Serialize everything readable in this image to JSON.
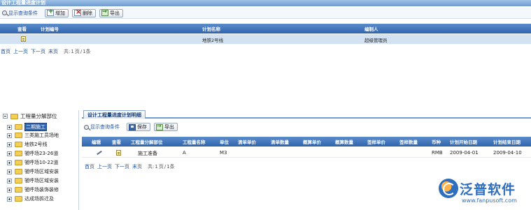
{
  "top_panel": {
    "title": "设计工程量进度计划",
    "toolbar": {
      "show_query": "显示查询条件",
      "add": "增加",
      "delete": "删除",
      "export": "导出"
    },
    "columns": [
      "查看",
      "计划编号",
      "计划名称",
      "编制人"
    ],
    "rows": [
      {
        "plan_no": "",
        "plan_name": "地铁2号线",
        "author": "超级管理员"
      }
    ],
    "pager": {
      "first": "首页",
      "prev": "上一页",
      "next": "下一页",
      "last": "末页",
      "total_label": "共:",
      "current": "1",
      "page_unit": "页",
      "sep": "/",
      "total_count": "1条"
    }
  },
  "tree": {
    "root": "工程量分解部位",
    "items": [
      {
        "label": "二期施工",
        "selected": true
      },
      {
        "label": "三类施工员场地"
      },
      {
        "label": "地铁2号线"
      },
      {
        "label": "虢呼场23-26道"
      },
      {
        "label": "虢呼场10-22道"
      },
      {
        "label": "虢呼场区域安装"
      },
      {
        "label": "虢呼场区域安装"
      },
      {
        "label": "虢呼场装饰装修"
      },
      {
        "label": "达成场拆迁及"
      }
    ]
  },
  "detail_panel": {
    "tab": "设计工程量进度计划明细",
    "toolbar": {
      "show_query": "显示查询条件",
      "save": "保存",
      "export": "导出"
    },
    "columns": [
      "编辑",
      "查看",
      "工程量分解部位",
      "工程量名称",
      "单位",
      "清单单价",
      "清单数量",
      "概算单价",
      "概算数量",
      "签样单价",
      "签样数量",
      "币种",
      "计划开始日期",
      "计划结束日期"
    ],
    "rows": [
      {
        "part": "施工准备",
        "name": "A",
        "unit": "M3",
        "currency": "RMB",
        "start": "2009-04-01",
        "end": "2009-04-10"
      }
    ],
    "pager": {
      "first": "首页",
      "prev": "上一页",
      "next": "下一页",
      "last": "末页",
      "total_label": "共:",
      "current": "1",
      "page_unit": "页",
      "sep": "/",
      "total_count": "1条"
    }
  },
  "logo": {
    "name": "泛普软件",
    "url": "www.fanpusoft.com"
  },
  "colors": {
    "header_blue": "#2f64ad",
    "selected_row": "#d3e2f3",
    "brand": "#2f6dbd"
  }
}
